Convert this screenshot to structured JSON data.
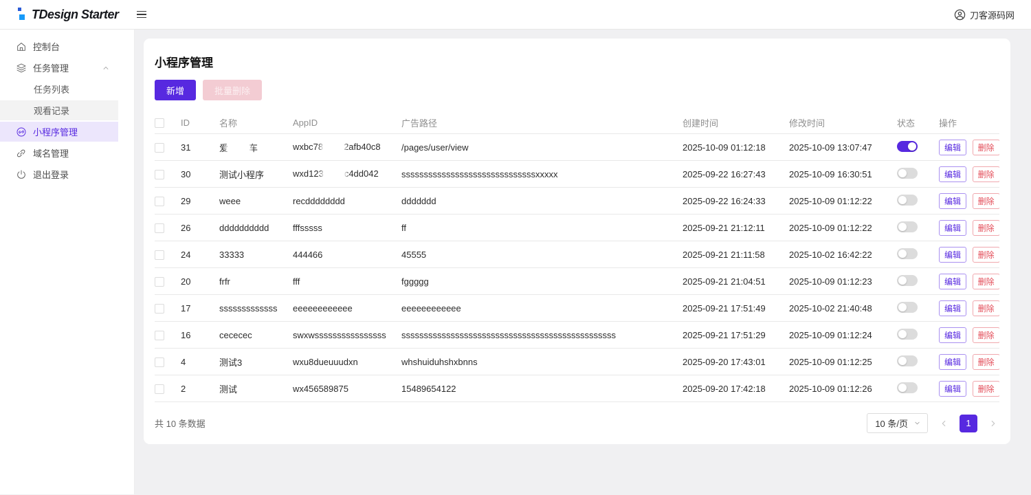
{
  "colors": {
    "primary": "#5729e0",
    "danger": "#e34d59",
    "sidebar_active_bg": "#ece6fc"
  },
  "header": {
    "logo_text": "TDesign Starter",
    "user_name": "刀客源码网"
  },
  "sidebar": {
    "items": [
      {
        "label": "控制台"
      },
      {
        "label": "任务管理",
        "children": [
          {
            "label": "任务列表"
          },
          {
            "label": "观看记录"
          }
        ]
      },
      {
        "label": "小程序管理"
      },
      {
        "label": "域名管理"
      },
      {
        "label": "退出登录"
      }
    ]
  },
  "main": {
    "title": "小程序管理",
    "toolbar": {
      "add_label": "新增",
      "batch_delete_label": "批量删除"
    },
    "table": {
      "columns": {
        "id": "ID",
        "name": "名称",
        "appid": "AppID",
        "path": "广告路径",
        "created": "创建时间",
        "modified": "修改时间",
        "status": "状态",
        "ops": "操作"
      },
      "edit_label": "编辑",
      "delete_label": "删除",
      "rows": [
        {
          "id": "31",
          "name": {
            "pre": "爱",
            "post": "车",
            "censored": true
          },
          "appid": {
            "pre": "wxbc78",
            "post": "2afb40c8",
            "censored": true
          },
          "path": "/pages/user/view",
          "created": "2025-10-09 01:12:18",
          "modified": "2025-10-09 13:07:47",
          "status": "on"
        },
        {
          "id": "30",
          "name": "测试小程序",
          "appid": {
            "pre": "wxd123",
            "post": "c4dd042",
            "censored": true
          },
          "path": "ssssssssssssssssssssssssssssssxxxxx",
          "created": "2025-09-22 16:27:43",
          "modified": "2025-10-09 16:30:51",
          "status": "off"
        },
        {
          "id": "29",
          "name": "weee",
          "appid": "recdddddddd",
          "path": "ddddddd",
          "created": "2025-09-22 16:24:33",
          "modified": "2025-10-09 01:12:22",
          "status": "off"
        },
        {
          "id": "26",
          "name": "dddddddddd",
          "appid": "fffsssss",
          "path": "ff",
          "created": "2025-09-21 21:12:11",
          "modified": "2025-10-09 01:12:22",
          "status": "off"
        },
        {
          "id": "24",
          "name": "33333",
          "appid": "444466",
          "path": "45555",
          "created": "2025-09-21 21:11:58",
          "modified": "2025-10-02 16:42:22",
          "status": "off"
        },
        {
          "id": "20",
          "name": "frfr",
          "appid": "fff",
          "path": "fggggg",
          "created": "2025-09-21 21:04:51",
          "modified": "2025-10-09 01:12:23",
          "status": "off"
        },
        {
          "id": "17",
          "name": "sssssssssssss",
          "appid": "eeeeeeeeeeee",
          "path": "eeeeeeeeeeee",
          "created": "2025-09-21 17:51:49",
          "modified": "2025-10-02 21:40:48",
          "status": "off"
        },
        {
          "id": "16",
          "name": "cececec",
          "appid": "swxwssssssssssssssss",
          "path": "ssssssssssssssssssssssssssssssssssssssssssssssss",
          "created": "2025-09-21 17:51:29",
          "modified": "2025-10-09 01:12:24",
          "status": "off"
        },
        {
          "id": "4",
          "name": "测试3",
          "appid": "wxu8dueuuudxn",
          "path": "whshuiduhshxbnns",
          "created": "2025-09-20 17:43:01",
          "modified": "2025-10-09 01:12:25",
          "status": "off"
        },
        {
          "id": "2",
          "name": "测试",
          "appid": "wx456589875",
          "path": "15489654122",
          "created": "2025-09-20 17:42:18",
          "modified": "2025-10-09 01:12:26",
          "status": "off"
        }
      ]
    },
    "pagination": {
      "total_text": "共 10 条数据",
      "page_size_label": "10 条/页",
      "current_page": "1"
    }
  }
}
